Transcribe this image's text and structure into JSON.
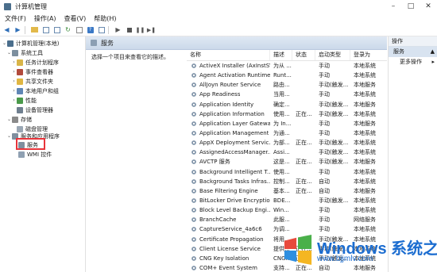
{
  "window": {
    "title": "计算机管理"
  },
  "menu": [
    "文件(F)",
    "操作(A)",
    "查看(V)",
    "帮助(H)"
  ],
  "tree": {
    "root": "计算机管理(本地)",
    "system_tools": "系统工具",
    "task_scheduler": "任务计划程序",
    "event_viewer": "事件查看器",
    "shared_folders": "共享文件夹",
    "local_users": "本地用户和组",
    "performance": "性能",
    "device_manager": "设备管理器",
    "storage": "存储",
    "disk_management": "磁盘管理",
    "services_apps": "服务和应用程序",
    "services": "服务",
    "wmi": "WMI 控件"
  },
  "center": {
    "header": "服务",
    "description": "选择一个项目来查看它的描述。",
    "columns": {
      "name": "名称",
      "desc": "描述",
      "status": "状态",
      "startup": "启动类型",
      "logon": "登录为"
    }
  },
  "services": [
    {
      "name": "ActiveX Installer (AxInstSV)",
      "desc": "为从 ...",
      "status": "",
      "startup": "手动",
      "logon": "本地系统"
    },
    {
      "name": "Agent Activation Runtime...",
      "desc": "Runt...",
      "status": "",
      "startup": "手动",
      "logon": "本地系统"
    },
    {
      "name": "AllJoyn Router Service",
      "desc": "路由...",
      "status": "",
      "startup": "手动(触发...",
      "logon": "本地服务"
    },
    {
      "name": "App Readiness",
      "desc": "当用...",
      "status": "",
      "startup": "手动",
      "logon": "本地系统"
    },
    {
      "name": "Application Identity",
      "desc": "确定...",
      "status": "",
      "startup": "手动(触发...",
      "logon": "本地服务"
    },
    {
      "name": "Application Information",
      "desc": "使用...",
      "status": "正在...",
      "startup": "手动(触发...",
      "logon": "本地系统"
    },
    {
      "name": "Application Layer Gatewa...",
      "desc": "为 In...",
      "status": "",
      "startup": "手动",
      "logon": "本地服务"
    },
    {
      "name": "Application Management",
      "desc": "为通...",
      "status": "",
      "startup": "手动",
      "logon": "本地系统"
    },
    {
      "name": "AppX Deployment Servic...",
      "desc": "为部...",
      "status": "正在...",
      "startup": "手动(触发...",
      "logon": "本地系统"
    },
    {
      "name": "AssignedAccessManager...",
      "desc": "Assi...",
      "status": "",
      "startup": "手动(触发...",
      "logon": "本地系统"
    },
    {
      "name": "AVCTP 服务",
      "desc": "这是...",
      "status": "正在...",
      "startup": "手动(触发...",
      "logon": "本地服务"
    },
    {
      "name": "Background Intelligent T...",
      "desc": "使用...",
      "status": "",
      "startup": "手动",
      "logon": "本地系统"
    },
    {
      "name": "Background Tasks Infras...",
      "desc": "控制...",
      "status": "正在...",
      "startup": "自动",
      "logon": "本地系统"
    },
    {
      "name": "Base Filtering Engine",
      "desc": "基本...",
      "status": "正在...",
      "startup": "自动",
      "logon": "本地服务"
    },
    {
      "name": "BitLocker Drive Encryptio...",
      "desc": "BDE...",
      "status": "",
      "startup": "手动(触发...",
      "logon": "本地系统"
    },
    {
      "name": "Block Level Backup Engi...",
      "desc": "Win...",
      "status": "",
      "startup": "手动",
      "logon": "本地系统"
    },
    {
      "name": "BranchCache",
      "desc": "此服...",
      "status": "",
      "startup": "手动",
      "logon": "网络服务"
    },
    {
      "name": "CaptureService_4a6c6",
      "desc": "为调...",
      "status": "",
      "startup": "手动",
      "logon": "本地系统"
    },
    {
      "name": "Certificate Propagation",
      "desc": "将用...",
      "status": "",
      "startup": "手动(触发...",
      "logon": "本地系统"
    },
    {
      "name": "Client License Service",
      "desc": "提供...",
      "status": "正在...",
      "startup": "手动(触发...",
      "logon": "本地系统"
    },
    {
      "name": "CNG Key Isolation",
      "desc": "CNG...",
      "status": "正在...",
      "startup": "手动(触发...",
      "logon": "本地系统"
    },
    {
      "name": "COM+ Event System",
      "desc": "支持...",
      "status": "正在...",
      "startup": "自动",
      "logon": "本地服务"
    }
  ],
  "actions": {
    "header": "操作",
    "section": "服务",
    "more": "更多操作"
  },
  "watermark": {
    "title": "Windows 系统之家",
    "url": "www.bjjmlv.com"
  }
}
